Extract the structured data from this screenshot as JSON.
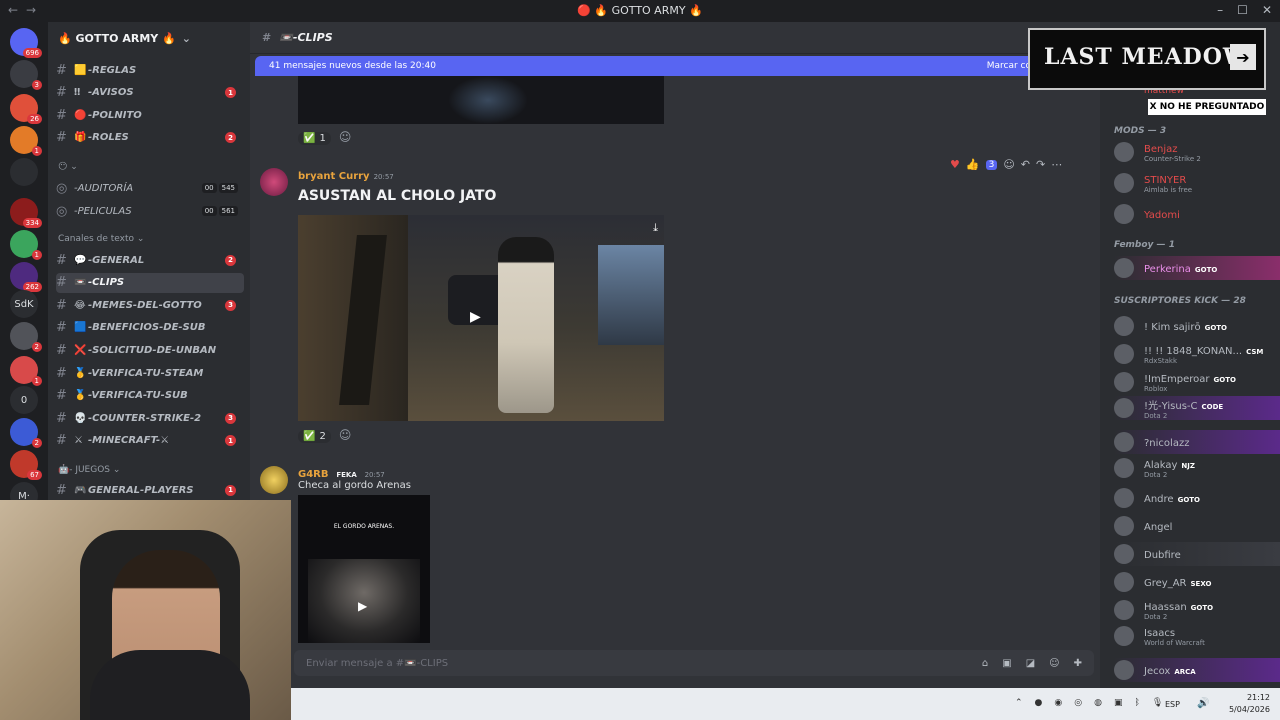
{
  "window": {
    "title": "🔴 🔥 GOTTO ARMY 🔥"
  },
  "server_rail": [
    {
      "label": "",
      "badge": "696"
    },
    {
      "label": "",
      "badge": "3"
    },
    {
      "label": "",
      "badge": "26"
    },
    {
      "label": "",
      "badge": "1"
    },
    {
      "label": "",
      "badge": ""
    },
    {
      "label": "",
      "badge": "334"
    },
    {
      "label": "",
      "badge": "1"
    },
    {
      "label": "",
      "badge": "262"
    },
    {
      "label": "SdK",
      "badge": ""
    },
    {
      "label": "",
      "badge": "2"
    },
    {
      "label": "",
      "badge": "1"
    },
    {
      "label": "0",
      "badge": ""
    },
    {
      "label": "",
      "badge": "2"
    },
    {
      "label": "",
      "badge": "67"
    },
    {
      "label": "M·",
      "badge": ""
    }
  ],
  "server": {
    "name": "🔥 GOTTO ARMY 🔥"
  },
  "channels": [
    {
      "emoji": "🟨",
      "name": "-REGLAS",
      "count": ""
    },
    {
      "emoji": "‼",
      "name": "-AVISOS",
      "count": "1"
    },
    {
      "emoji": "🔴",
      "name": "-POLNITO",
      "count": ""
    },
    {
      "emoji": "🎁",
      "name": "-ROLES",
      "count": "2"
    }
  ],
  "voice_channels": [
    {
      "name": "-AUDITORÍA",
      "a": "00",
      "b": "545"
    },
    {
      "name": "-PELICULAS",
      "a": "00",
      "b": "561"
    }
  ],
  "text_category": "Canales de texto",
  "text_channels": [
    {
      "emoji": "💬",
      "name": "-GENERAL",
      "count": "2"
    },
    {
      "emoji": "📼",
      "name": "-CLIPS",
      "count": ""
    },
    {
      "emoji": "😂",
      "name": "-MEMES-DEL-GOTTO",
      "count": "3"
    },
    {
      "emoji": "🟦",
      "name": "-BENEFICIOS-DE-SUB",
      "count": ""
    },
    {
      "emoji": "❌",
      "name": "-SOLICITUD-DE-UNBAN",
      "count": ""
    },
    {
      "emoji": "🥇",
      "name": "-VERIFICA-TU-STEAM",
      "count": ""
    },
    {
      "emoji": "🥇",
      "name": "-VERIFICA-TU-SUB",
      "count": ""
    },
    {
      "emoji": "💀",
      "name": "-COUNTER-STRIKE-2",
      "count": "3"
    },
    {
      "emoji": "⚔",
      "name": "-MINECRAFT-⚔",
      "count": "1"
    }
  ],
  "games_category": "- JUEGOS",
  "games_channels": [
    {
      "emoji": "🎮",
      "name": "GENERAL-PLAYERS",
      "count": "1"
    }
  ],
  "channel": {
    "name": "📼-CLIPS",
    "new_messages": "41 mensajes nuevos desde las 20:40",
    "mark_read": "Marcar co",
    "composer_placeholder": "Enviar mensaje a #📼-CLIPS"
  },
  "messages": [
    {
      "reaction_emoji": "✅",
      "reaction_count": "1"
    },
    {
      "author": "bryant Curry",
      "time": "20:57",
      "title": "ASUSTAN AL CHOLO JATO",
      "reaction_emoji": "✅",
      "reaction_count": "2",
      "hover_reaction_count": "3"
    },
    {
      "author": "G4RB",
      "author_tag": "FEKA",
      "time": "20:57",
      "text": "Checa al gordo Arenas",
      "video_caption": "EL GORDO ARENAS."
    }
  ],
  "members": {
    "top_name": "matthew",
    "mods_header": "MODS — 3",
    "mods": [
      {
        "name": "Benjaz",
        "sub": "Counter-Strike 2",
        "color": "#e34b4b"
      },
      {
        "name": "STINYER",
        "sub": "Aimlab is free",
        "color": "#e34b4b"
      },
      {
        "name": "Yadomi",
        "sub": "",
        "color": "#e34b4b"
      }
    ],
    "femboy_header": "Femboy — 1",
    "femboy": [
      {
        "name": "Perkerina",
        "tag": "GOTO",
        "sub": "",
        "color": "#e88ee8"
      }
    ],
    "subs_header": "SUSCRIPTORES KICK — 28",
    "subs": [
      {
        "name": "! Kim sajirō",
        "tag": "GOTO",
        "sub": ""
      },
      {
        "name": "!! !! 1848_KONAN...",
        "tag": "CSM",
        "sub": "RdxStakk"
      },
      {
        "name": "!ImEmperoar",
        "tag": "GOTO",
        "sub": "Roblox"
      },
      {
        "name": "!光-Yisus-C",
        "tag": "CODE",
        "sub": "Dota 2"
      },
      {
        "name": "?nicolazz",
        "tag": "",
        "sub": ""
      },
      {
        "name": "Alakay",
        "tag": "NJZ",
        "sub": "Dota 2"
      },
      {
        "name": "Andre",
        "tag": "GOTO",
        "sub": ""
      },
      {
        "name": "Angel",
        "tag": "",
        "sub": ""
      },
      {
        "name": "Dubfire",
        "tag": "",
        "sub": ""
      },
      {
        "name": "Grey_AR",
        "tag": "SEXO",
        "sub": ""
      },
      {
        "name": "Haassan",
        "tag": "GOTO",
        "sub": "Dota 2"
      },
      {
        "name": "Isaacs",
        "tag": "",
        "sub": "World of Warcraft"
      },
      {
        "name": "Jecox",
        "tag": "ARCA",
        "sub": ""
      }
    ]
  },
  "overlay": {
    "title": "LAST MEADOW",
    "caption": "X NO HE PREGUNTADO"
  },
  "taskbar": {
    "lang": "ESP",
    "time": "21:12",
    "date": "5/04/2026"
  }
}
